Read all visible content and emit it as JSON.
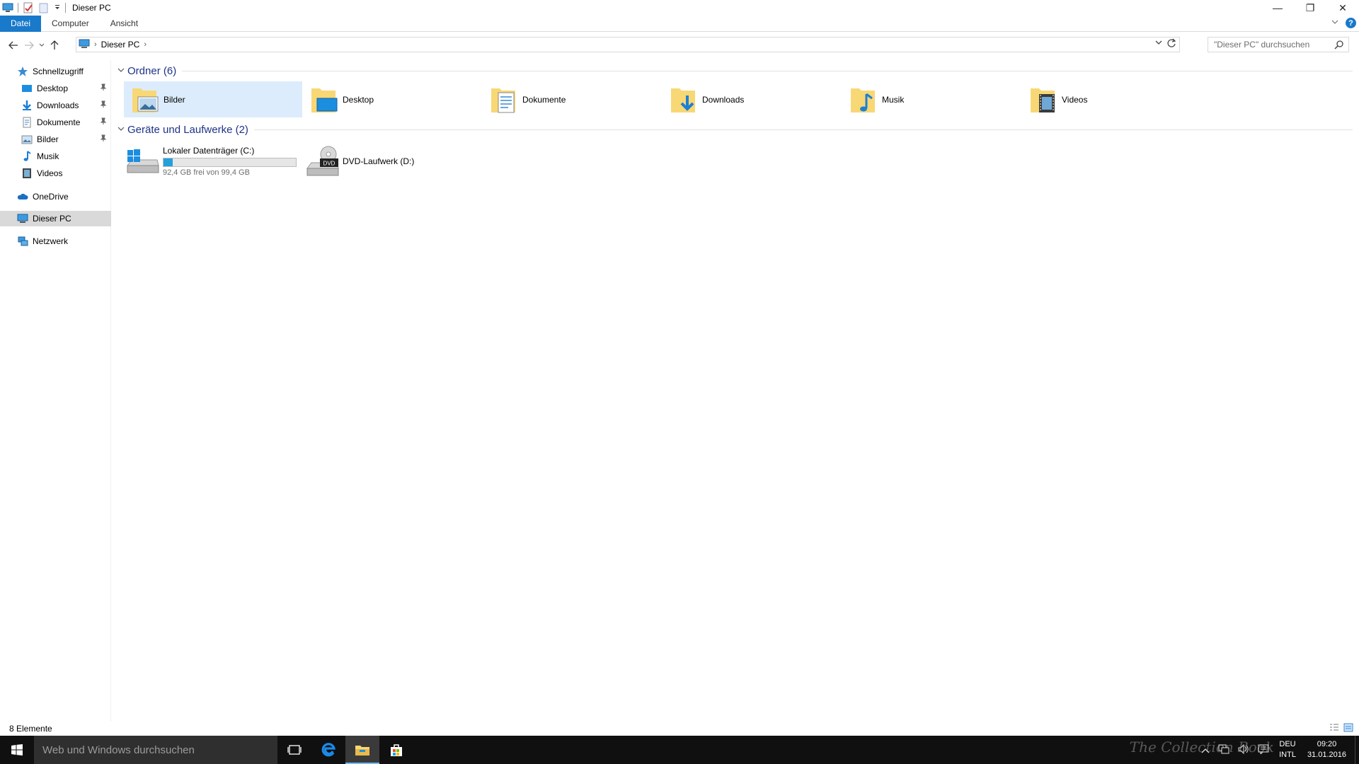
{
  "window": {
    "title": "Dieser PC",
    "minimize_glyph": "—",
    "restore_glyph": "❐",
    "close_glyph": "✕"
  },
  "ribbon": {
    "tabs": [
      "Datei",
      "Computer",
      "Ansicht"
    ],
    "active_tab": "Datei",
    "help_glyph": "?"
  },
  "address": {
    "crumbs": [
      "Dieser PC"
    ],
    "search_placeholder": "\"Dieser PC\" durchsuchen"
  },
  "nav": {
    "quick_access": "Schnellzugriff",
    "pinned": [
      {
        "label": "Desktop",
        "icon": "desktop-icon"
      },
      {
        "label": "Downloads",
        "icon": "downloads-icon"
      },
      {
        "label": "Dokumente",
        "icon": "documents-icon"
      },
      {
        "label": "Bilder",
        "icon": "pictures-icon"
      }
    ],
    "unpinned": [
      {
        "label": "Musik",
        "icon": "music-icon"
      },
      {
        "label": "Videos",
        "icon": "videos-icon"
      }
    ],
    "onedrive": "OneDrive",
    "this_pc": "Dieser PC",
    "network": "Netzwerk"
  },
  "content": {
    "folders_header": "Ordner (6)",
    "folders": [
      {
        "label": "Bilder",
        "icon": "pictures-folder-icon"
      },
      {
        "label": "Desktop",
        "icon": "desktop-folder-icon"
      },
      {
        "label": "Dokumente",
        "icon": "documents-folder-icon"
      },
      {
        "label": "Downloads",
        "icon": "downloads-folder-icon"
      },
      {
        "label": "Musik",
        "icon": "music-folder-icon"
      },
      {
        "label": "Videos",
        "icon": "videos-folder-icon"
      }
    ],
    "drives_header": "Geräte und Laufwerke (2)",
    "drives": [
      {
        "name": "Lokaler Datenträger (C:)",
        "free_text": "92,4 GB frei von 99,4 GB",
        "used_fraction": 0.07
      },
      {
        "name": "DVD-Laufwerk (D:)",
        "dvd_label": "DVD"
      }
    ]
  },
  "status": {
    "item_count": "8 Elemente"
  },
  "taskbar": {
    "search_placeholder": "Web und Windows durchsuchen",
    "language_top": "DEU",
    "language_bottom": "INTL",
    "time": "09:20",
    "date": "31.01.2016",
    "watermark": "The Collection Book"
  },
  "colors": {
    "accent": "#1979ca",
    "selection": "#dcecfc",
    "drive_fill": "#26a0da",
    "folder_yellow": "#f8d775"
  }
}
